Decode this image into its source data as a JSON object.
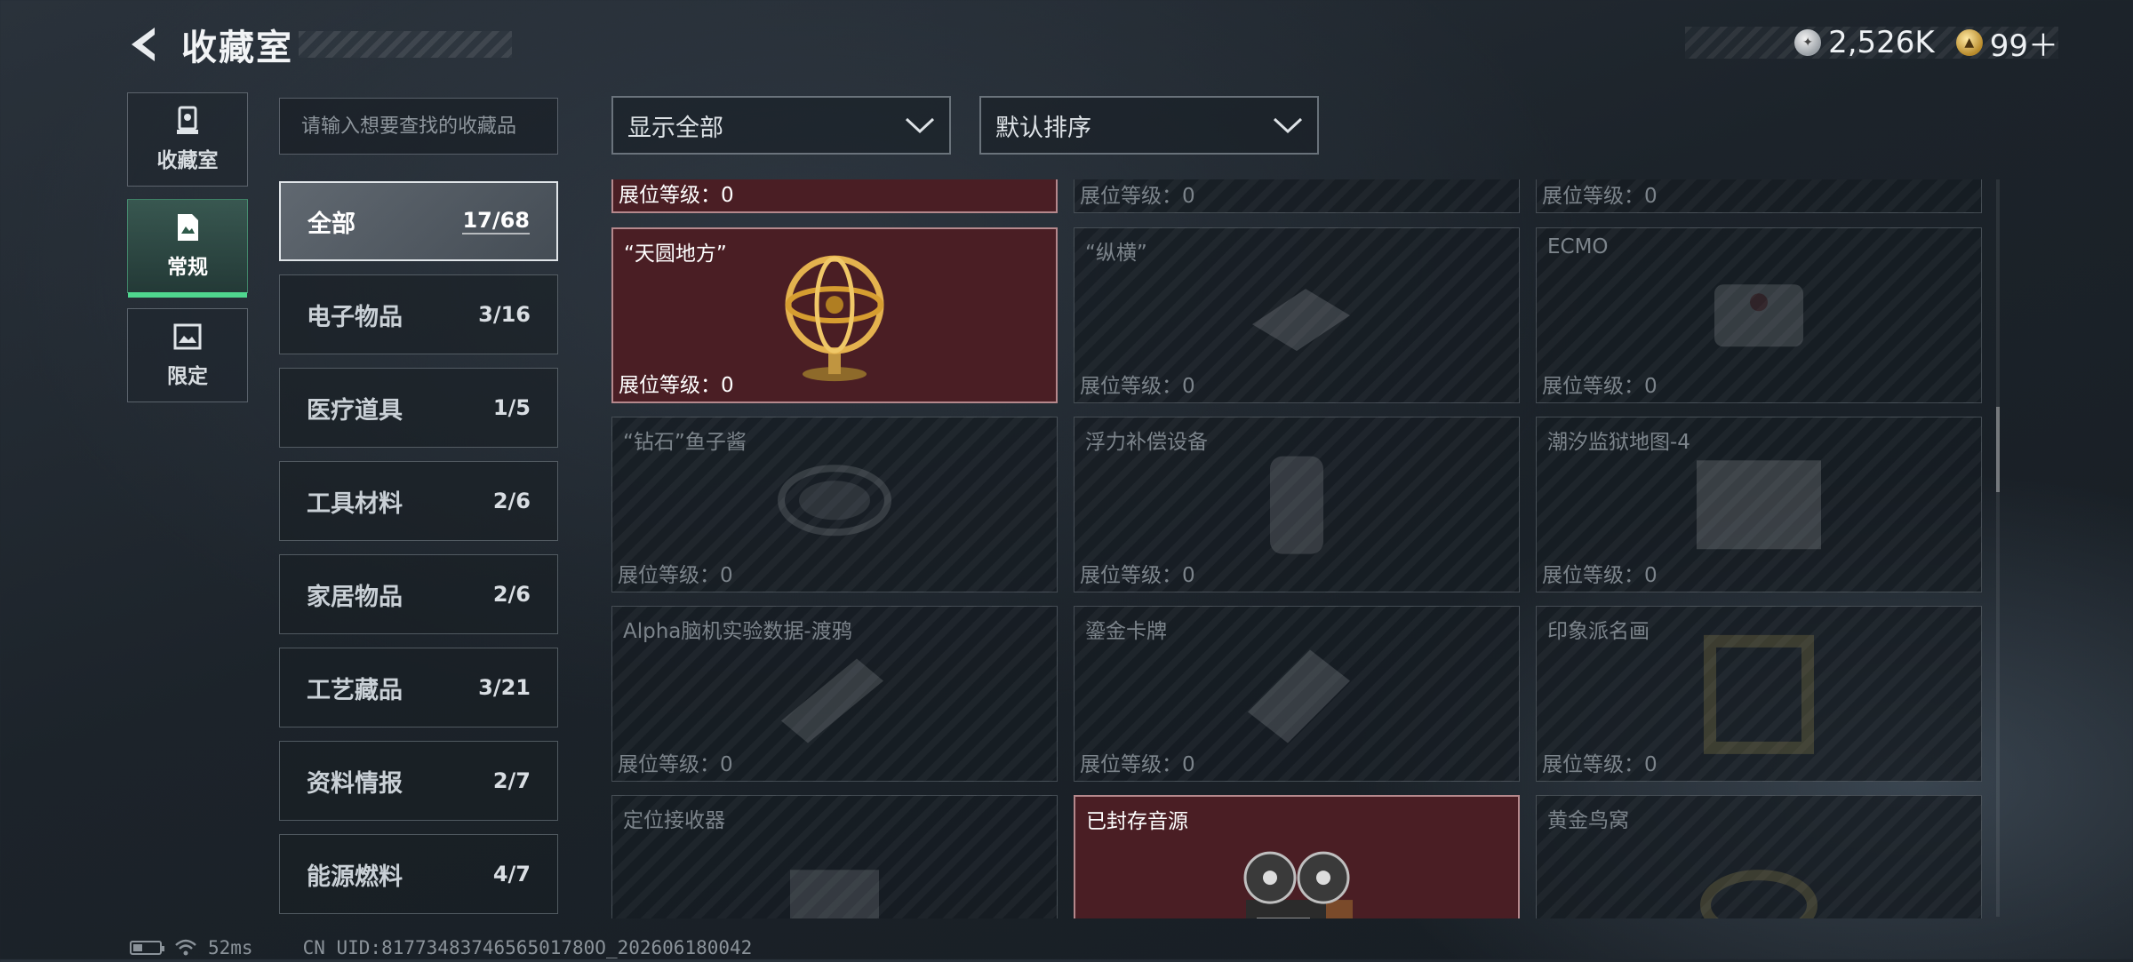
{
  "header": {
    "title": "收藏室"
  },
  "currency": [
    {
      "icon": "silver-coin-icon",
      "value": "2,526K"
    },
    {
      "icon": "gold-coin-icon",
      "value": "99＋"
    }
  ],
  "side_tabs": [
    {
      "label": "收藏室",
      "icon": "trophy-icon",
      "active": false
    },
    {
      "label": "常规",
      "icon": "document-icon",
      "active": true
    },
    {
      "label": "限定",
      "icon": "picture-icon",
      "active": false
    }
  ],
  "search": {
    "placeholder": "请输入想要查找的收藏品"
  },
  "categories": [
    {
      "label": "全部",
      "count": "17/68",
      "active": true
    },
    {
      "label": "电子物品",
      "count": "3/16"
    },
    {
      "label": "医疗道具",
      "count": "1/5"
    },
    {
      "label": "工具材料",
      "count": "2/6"
    },
    {
      "label": "家居物品",
      "count": "2/6"
    },
    {
      "label": "工艺藏品",
      "count": "3/21"
    },
    {
      "label": "资料情报",
      "count": "2/7"
    },
    {
      "label": "能源燃料",
      "count": "4/7"
    }
  ],
  "filters": {
    "display": "显示全部",
    "sort": "默认排序"
  },
  "items": [
    {
      "name": "",
      "level": "展位等级：0",
      "owned": true,
      "icon": "item-icon"
    },
    {
      "name": "",
      "level": "展位等级：0",
      "owned": false,
      "icon": "item-icon"
    },
    {
      "name": "",
      "level": "展位等级：0",
      "owned": false,
      "icon": "item-icon"
    },
    {
      "name": "“天圆地方”",
      "level": "展位等级：0",
      "owned": true,
      "icon": "armillary-sphere-icon"
    },
    {
      "name": "“纵横”",
      "level": "展位等级：0",
      "owned": false,
      "icon": "chessboard-icon"
    },
    {
      "name": "ECMO",
      "level": "展位等级：0",
      "owned": false,
      "icon": "ecmo-machine-icon"
    },
    {
      "name": "“钻石”鱼子酱",
      "level": "展位等级：0",
      "owned": false,
      "icon": "caviar-tin-icon"
    },
    {
      "name": "浮力补偿设备",
      "level": "展位等级：0",
      "owned": false,
      "icon": "buoyancy-device-icon"
    },
    {
      "name": "潮汐监狱地图-4",
      "level": "展位等级：0",
      "owned": false,
      "icon": "map-icon"
    },
    {
      "name": "Alpha脑机实验数据-渡鸦",
      "level": "展位等级：0",
      "owned": false,
      "icon": "data-device-icon"
    },
    {
      "name": "鎏金卡牌",
      "level": "展位等级：0",
      "owned": false,
      "icon": "card-icon"
    },
    {
      "name": "印象派名画",
      "level": "展位等级：0",
      "owned": false,
      "icon": "painting-frame-icon"
    },
    {
      "name": "定位接收器",
      "level": "",
      "owned": false,
      "icon": "receiver-icon"
    },
    {
      "name": "已封存音源",
      "level": "",
      "owned": true,
      "icon": "reel-tape-recorder-icon"
    },
    {
      "name": "黄金鸟窝",
      "level": "",
      "owned": false,
      "icon": "bird-nest-icon"
    }
  ],
  "status": {
    "ping": "52ms",
    "uid": "CN UID:8177348374656501780O_202606180042"
  }
}
